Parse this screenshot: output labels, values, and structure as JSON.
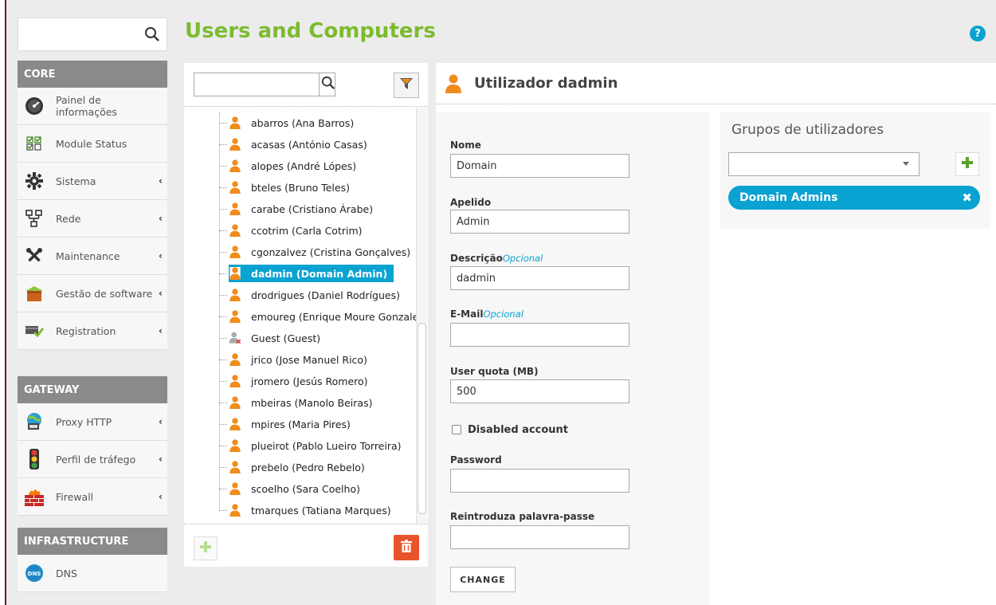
{
  "page": {
    "title": "Users and Computers",
    "help": "?"
  },
  "sidebar": {
    "search_value": "",
    "sections": [
      {
        "heading": "CORE"
      },
      {
        "heading": "GATEWAY"
      },
      {
        "heading": "INFRASTRUCTURE"
      }
    ],
    "core_items": [
      {
        "label": "Painel de informações",
        "icon": "dashboard-gauge-icon",
        "has_chevron": false
      },
      {
        "label": "Module Status",
        "icon": "module-checkboxes-icon",
        "has_chevron": false
      },
      {
        "label": "Sistema",
        "icon": "gear-icon",
        "has_chevron": true
      },
      {
        "label": "Rede",
        "icon": "network-icon",
        "has_chevron": true
      },
      {
        "label": "Maintenance",
        "icon": "tools-icon",
        "has_chevron": true
      },
      {
        "label": "Gestão de software",
        "icon": "package-box-icon",
        "has_chevron": true
      },
      {
        "label": "Registration",
        "icon": "registration-icon",
        "has_chevron": true
      }
    ],
    "gateway_items": [
      {
        "label": "Proxy HTTP",
        "icon": "proxy-globe-icon",
        "has_chevron": true
      },
      {
        "label": "Perfil de tráfego",
        "icon": "traffic-light-icon",
        "has_chevron": true
      },
      {
        "label": "Firewall",
        "icon": "firewall-icon",
        "has_chevron": true
      }
    ],
    "infrastructure_items": [
      {
        "label": "DNS",
        "icon": "dns-icon",
        "has_chevron": false
      }
    ]
  },
  "tree": {
    "search_value": "",
    "users": [
      {
        "label": "abarros (Ana Barros)",
        "kind": "user",
        "selected": false
      },
      {
        "label": "acasas (António Casas)",
        "kind": "user",
        "selected": false
      },
      {
        "label": "alopes (André Lópes)",
        "kind": "user",
        "selected": false
      },
      {
        "label": "bteles (Bruno Teles)",
        "kind": "user",
        "selected": false
      },
      {
        "label": "carabe (Cristiano Árabe)",
        "kind": "user",
        "selected": false
      },
      {
        "label": "ccotrim (Carla Cotrim)",
        "kind": "user",
        "selected": false
      },
      {
        "label": "cgonzalvez (Cristina Gonçalves)",
        "kind": "user",
        "selected": false
      },
      {
        "label": "dadmin (Domain Admin)",
        "kind": "user",
        "selected": true
      },
      {
        "label": "drodrigues (Daniel Rodrígues)",
        "kind": "user",
        "selected": false
      },
      {
        "label": "emoureg (Enrique Moure Gonzale",
        "kind": "user",
        "selected": false
      },
      {
        "label": "Guest (Guest)",
        "kind": "disabled-user",
        "selected": false
      },
      {
        "label": "jrico (Jose Manuel Rico)",
        "kind": "user",
        "selected": false
      },
      {
        "label": "jromero (Jesús Romero)",
        "kind": "user",
        "selected": false
      },
      {
        "label": "mbeiras (Manolo Beiras)",
        "kind": "user",
        "selected": false
      },
      {
        "label": "mpires (Maria Pires)",
        "kind": "user",
        "selected": false
      },
      {
        "label": "plueirot (Pablo Lueiro Torreira)",
        "kind": "user",
        "selected": false
      },
      {
        "label": "prebelo (Pedro Rebelo)",
        "kind": "user",
        "selected": false
      },
      {
        "label": "scoelho (Sara Coelho)",
        "kind": "user",
        "selected": false
      },
      {
        "label": "tmarques (Tatiana Marques)",
        "kind": "user",
        "selected": false
      }
    ]
  },
  "user_form": {
    "header": "Utilizador dadmin",
    "nome_label": "Nome",
    "nome_value": "Domain",
    "apelido_label": "Apelido",
    "apelido_value": "Admin",
    "descricao_label": "Descrição",
    "descricao_optional": "Opcional",
    "descricao_value": "dadmin",
    "email_label": "E-Mail",
    "email_optional": "Opcional",
    "email_value": "",
    "quota_label": "User quota (MB)",
    "quota_value": "500",
    "disabled_label": "Disabled account",
    "disabled_checked": false,
    "password_label": "Password",
    "password_value": "",
    "repassword_label": "Reintroduza palavra-passe",
    "repassword_value": "",
    "change_button": "CHANGE"
  },
  "groups": {
    "title": "Grupos de utilizadores",
    "select_value": "",
    "members": [
      {
        "label": "Domain Admins",
        "remove": "✖"
      }
    ]
  },
  "colors": {
    "brand_green": "#7cbb2f",
    "accent_blue": "#0aa2d1",
    "delete_orange": "#e8532b",
    "user_orange": "#f08c1b",
    "section_gray": "#8a8a8a"
  }
}
